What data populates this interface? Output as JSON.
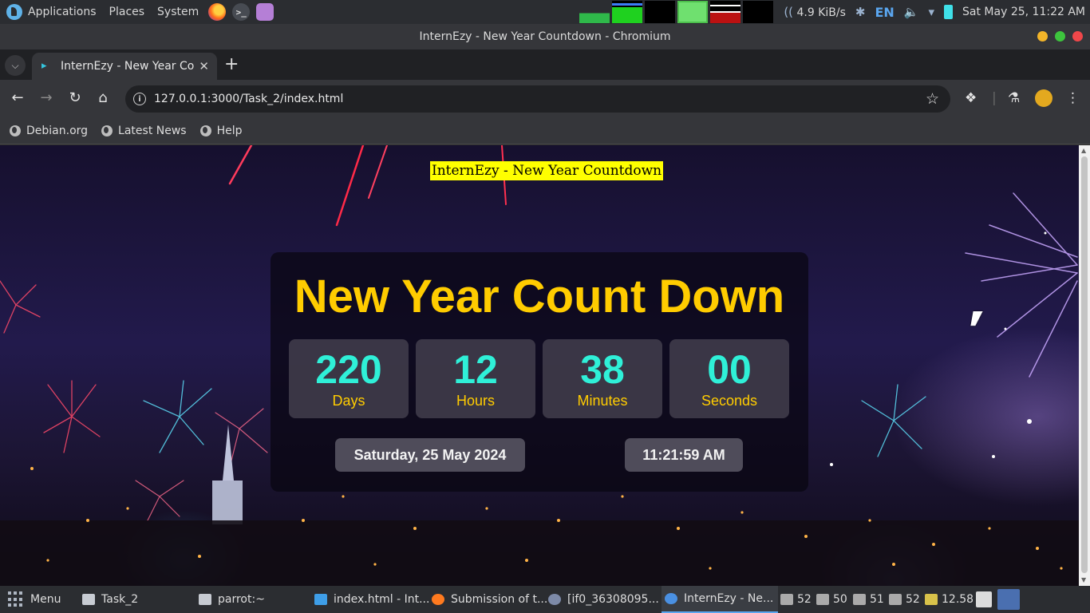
{
  "panel": {
    "menus": [
      "Applications",
      "Places",
      "System"
    ],
    "network_speed": "4.9 KiB/s",
    "keyboard_layout": "EN",
    "datetime": "Sat May 25, 11:22 AM"
  },
  "window": {
    "title": "InternEzy - New Year Countdown - Chromium"
  },
  "tabs": [
    {
      "label": "InternEzy - New Year Cou",
      "active": true
    }
  ],
  "toolbar": {
    "url": "127.0.0.1:3000/Task_2/index.html"
  },
  "bookmarks": [
    "Debian.org",
    "Latest News",
    "Help"
  ],
  "page": {
    "heading": "InternEzy - New Year Countdown",
    "title": "New Year Count Down",
    "countdown": [
      {
        "value": "220",
        "unit": "Days"
      },
      {
        "value": "12",
        "unit": "Hours"
      },
      {
        "value": "38",
        "unit": "Minutes"
      },
      {
        "value": "00",
        "unit": "Seconds"
      }
    ],
    "current_date": "Saturday, 25 May 2024",
    "current_time": "11:21:59 AM",
    "colors": {
      "title": "#ffcc00",
      "numbers": "#2ff0d8",
      "heading_bg": "#ffff00"
    }
  },
  "taskbar": {
    "menu_label": "Menu",
    "items": [
      {
        "label": "Task_2",
        "icon": "folder-icon"
      },
      {
        "label": "parrot:~",
        "icon": "terminal-icon"
      },
      {
        "label": "index.html - Int...",
        "icon": "vscode-icon"
      },
      {
        "label": "Submission of t...",
        "icon": "firefox-icon"
      },
      {
        "label": "[if0_36308095...",
        "icon": "browser-icon"
      },
      {
        "label": "InternEzy - Ne...",
        "icon": "chromium-icon",
        "active": true
      }
    ],
    "system": [
      "52",
      "50",
      "51",
      "52",
      "12.58"
    ]
  }
}
